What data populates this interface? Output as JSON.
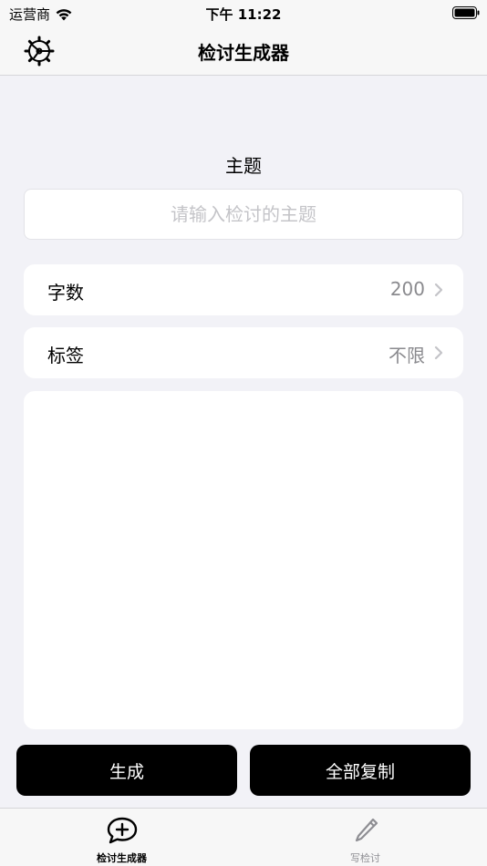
{
  "status_bar": {
    "carrier": "运营商",
    "time": "下午 11:22",
    "wifi_icon": "wifi-icon",
    "battery_icon": "battery-icon"
  },
  "nav": {
    "title": "检讨生成器",
    "settings_icon": "gear-icon"
  },
  "form": {
    "topic_label": "主题",
    "topic_placeholder": "请输入检讨的主题",
    "topic_value": "",
    "word_count": {
      "label": "字数",
      "value": "200"
    },
    "tag": {
      "label": "标签",
      "value": "不限"
    },
    "output_text": ""
  },
  "actions": {
    "generate": "生成",
    "copy_all": "全部复制"
  },
  "tabs": [
    {
      "label": "检讨生成器",
      "icon": "chat-plus-icon",
      "active": true
    },
    {
      "label": "写检讨",
      "icon": "pencil-icon",
      "active": false
    }
  ],
  "colors": {
    "background": "#f2f2f7",
    "card": "#ffffff",
    "button": "#000000",
    "secondary_text": "#8a8a8e",
    "placeholder": "#c4c4c8"
  }
}
